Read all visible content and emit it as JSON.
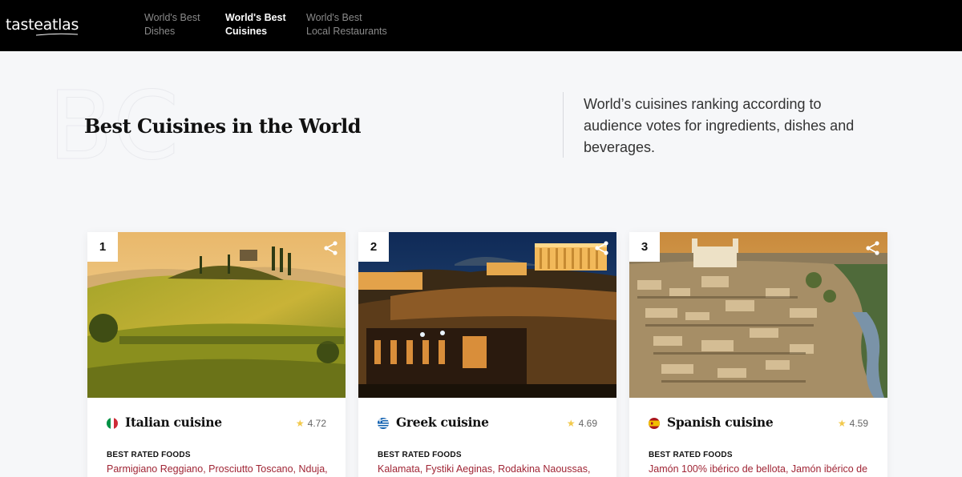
{
  "header": {
    "logo": "tasteatlas",
    "nav": [
      {
        "line1": "World's Best",
        "line2": "Dishes",
        "active": false
      },
      {
        "line1": "World's Best",
        "line2": "Cuisines",
        "active": true
      },
      {
        "line1": "World's Best",
        "line2": "Local Restaurants",
        "active": false
      }
    ]
  },
  "hero": {
    "bg_letters": "BC",
    "title": "Best Cuisines in the World",
    "description": "World’s cuisines ranking according to audience votes for ingredients, dishes and beverages."
  },
  "cards": [
    {
      "rank": "1",
      "name": "Italian cuisine",
      "rating": "4.72",
      "foods_label": "BEST RATED FOODS",
      "foods": "Parmigiano Reggiano, Prosciutto Toscano, Nduja,",
      "flag_colors": [
        "#009246",
        "#ffffff",
        "#ce2b37"
      ],
      "image_icon": "tuscany-landscape-photo"
    },
    {
      "rank": "2",
      "name": "Greek cuisine",
      "rating": "4.69",
      "foods_label": "BEST RATED FOODS",
      "foods": "Kalamata, Fystiki Aeginas, Rodakina Naoussas,",
      "flag_colors": [
        "#0d5eaf",
        "#ffffff"
      ],
      "image_icon": "acropolis-night-photo"
    },
    {
      "rank": "3",
      "name": "Spanish cuisine",
      "rating": "4.59",
      "foods_label": "BEST RATED FOODS",
      "foods": "Jamón 100% ibérico de bellota, Jamón ibérico de",
      "flag_colors": [
        "#aa151b",
        "#f1bf00"
      ],
      "image_icon": "toledo-city-photo"
    }
  ],
  "colors": {
    "header_bg": "#000000",
    "foods_text": "#a02535",
    "star": "#f2c94c"
  }
}
